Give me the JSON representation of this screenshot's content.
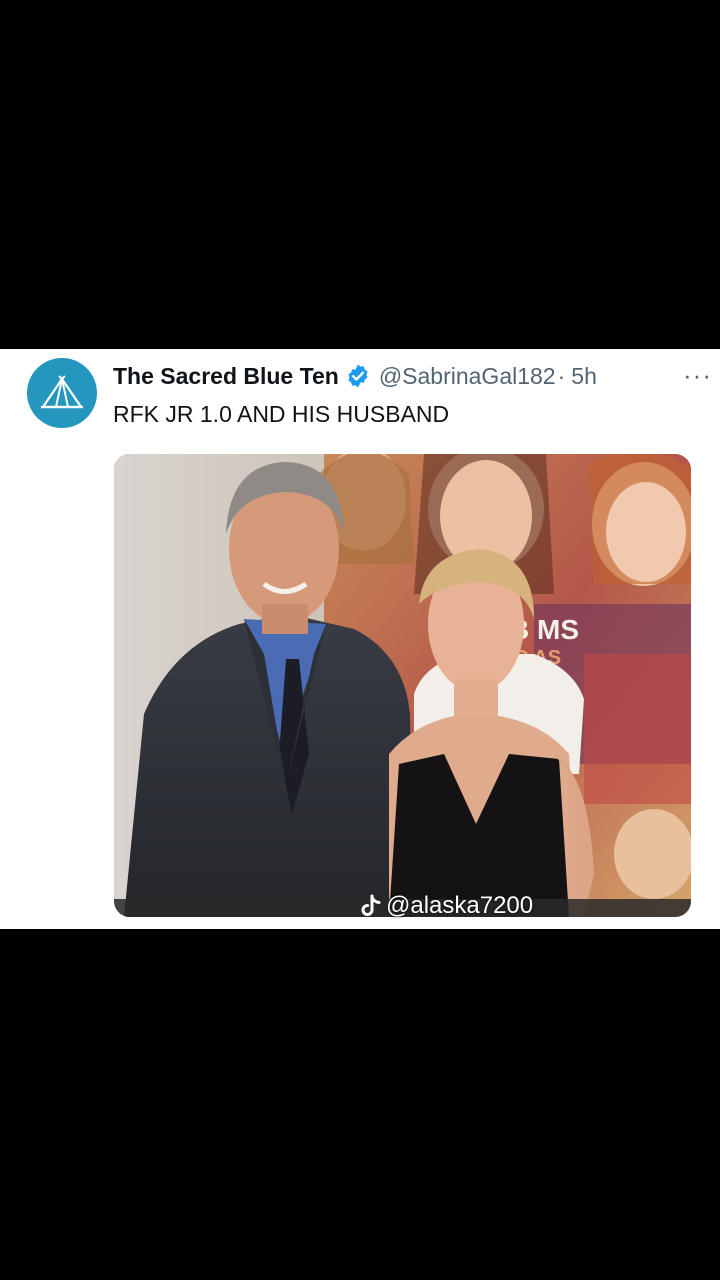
{
  "tweet": {
    "display_name": "The Sacred Blue Ten",
    "handle": "@SabrinaGal182",
    "separator": "·",
    "time": "5h",
    "more_label": "···",
    "text": "RFK JR 1.0 AND HIS HUSBAND",
    "avatar_icon": "tent-icon",
    "verified_icon": "verified-badge-icon",
    "avatar_color": "#2596be",
    "verified_color": "#1d9bf0"
  },
  "media": {
    "poster_text_partial": "B  MS",
    "poster_text_partial_2": "C   AS"
  },
  "watermark": {
    "icon": "tiktok-icon",
    "text": "@alaska7200"
  }
}
